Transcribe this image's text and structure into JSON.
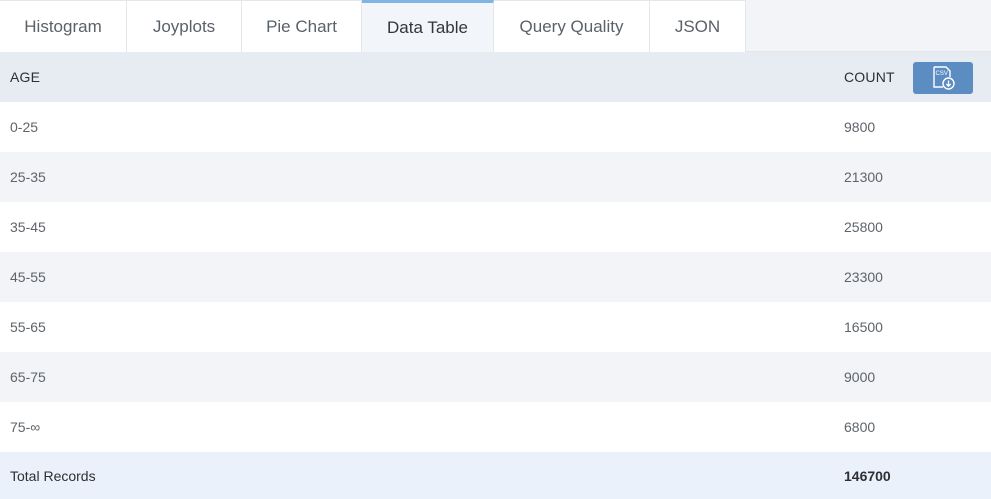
{
  "tabs": [
    {
      "label": "Histogram",
      "active": false
    },
    {
      "label": "Joyplots",
      "active": false
    },
    {
      "label": "Pie Chart",
      "active": false
    },
    {
      "label": "Data Table",
      "active": true
    },
    {
      "label": "Query Quality",
      "active": false
    },
    {
      "label": "JSON",
      "active": false
    }
  ],
  "table": {
    "columns": {
      "age": "AGE",
      "count": "COUNT"
    },
    "export_button_icon": "csv-download-icon",
    "export_icon_text": "CSV",
    "rows": [
      {
        "age": "0-25",
        "count": "9800"
      },
      {
        "age": "25-35",
        "count": "21300"
      },
      {
        "age": "35-45",
        "count": "25800"
      },
      {
        "age": "45-55",
        "count": "23300"
      },
      {
        "age": "55-65",
        "count": "16500"
      },
      {
        "age": "65-75",
        "count": "9000"
      },
      {
        "age": "75-∞",
        "count": "6800"
      }
    ],
    "total": {
      "label": "Total Records",
      "value": "146700"
    }
  },
  "colors": {
    "accent": "#5b8cc2",
    "active_tab_border": "#7fb4e3",
    "header_bg": "#e7ebf2",
    "stripe_bg": "#f2f4f7",
    "total_bg": "#ebf1fa"
  }
}
